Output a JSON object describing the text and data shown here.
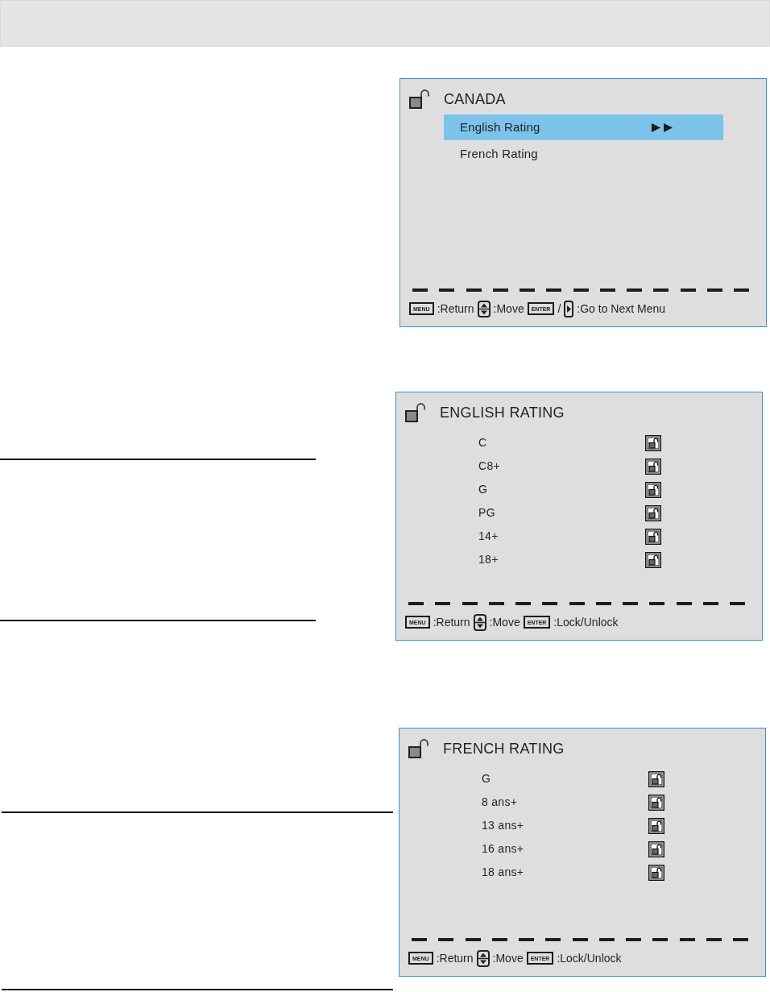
{
  "panels": [
    {
      "kind": "menu",
      "title": "CANADA",
      "items": [
        {
          "label": "English Rating",
          "selected": true
        },
        {
          "label": "French Rating",
          "selected": false
        }
      ],
      "footer": [
        {
          "kind": "key",
          "label": "MENU"
        },
        {
          "kind": "text",
          "text": ":Return"
        },
        {
          "kind": "updown-key"
        },
        {
          "kind": "text",
          "text": ":Move"
        },
        {
          "kind": "key",
          "label": "ENTER"
        },
        {
          "kind": "text",
          "text": "/"
        },
        {
          "kind": "right-key"
        },
        {
          "kind": "text",
          "text": ":Go to Next Menu"
        }
      ]
    },
    {
      "kind": "ratings",
      "title": "ENGLISH RATING",
      "items": [
        {
          "label": "C",
          "selected": false,
          "locked": false
        },
        {
          "label": "C8+",
          "selected": false,
          "locked": false
        },
        {
          "label": "G",
          "selected": false,
          "locked": false
        },
        {
          "label": "PG",
          "selected": false,
          "locked": false
        },
        {
          "label": "14+",
          "selected": false,
          "locked": false
        },
        {
          "label": "18+",
          "selected": false,
          "locked": false
        }
      ],
      "footer": [
        {
          "kind": "key",
          "label": "MENU"
        },
        {
          "kind": "text",
          "text": ":Return"
        },
        {
          "kind": "updown-key"
        },
        {
          "kind": "text",
          "text": ":Move"
        },
        {
          "kind": "key",
          "label": "ENTER"
        },
        {
          "kind": "text",
          "text": ":Lock/Unlock"
        }
      ]
    },
    {
      "kind": "ratings",
      "title": "FRENCH RATING",
      "items": [
        {
          "label": "G",
          "selected": false,
          "locked": false
        },
        {
          "label": "8 ans+",
          "selected": false,
          "locked": false
        },
        {
          "label": "13 ans+",
          "selected": false,
          "locked": false
        },
        {
          "label": "16 ans+",
          "selected": false,
          "locked": false
        },
        {
          "label": "18 ans+",
          "selected": false,
          "locked": false
        }
      ],
      "footer": [
        {
          "kind": "key",
          "label": "MENU"
        },
        {
          "kind": "text",
          "text": ":Return"
        },
        {
          "kind": "updown-key"
        },
        {
          "kind": "text",
          "text": ":Move"
        },
        {
          "kind": "key",
          "label": "ENTER"
        },
        {
          "kind": "text",
          "text": ":Lock/Unlock"
        }
      ]
    }
  ]
}
